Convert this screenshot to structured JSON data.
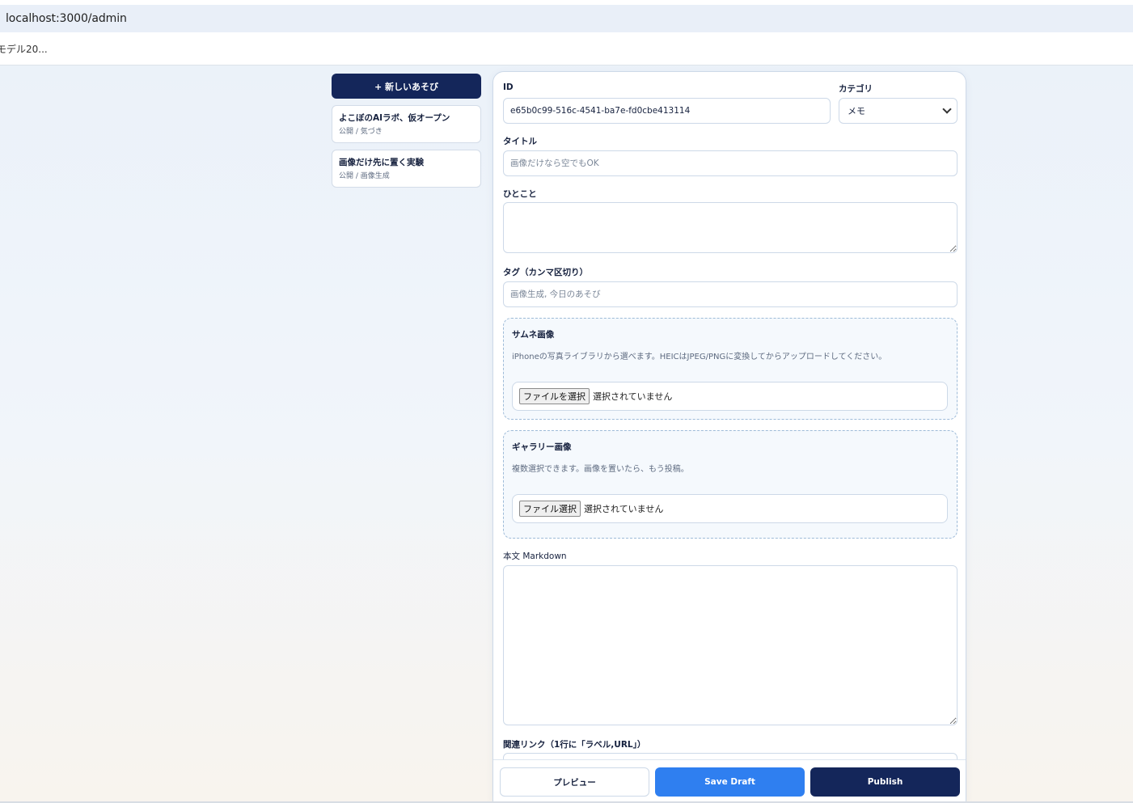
{
  "browser": {
    "url": "localhost:3000/admin",
    "bookmark": "モデル20..."
  },
  "sidebar": {
    "new_button": "+ 新しいあそび",
    "posts": [
      {
        "title": "よこぼのAIラボ、仮オープン",
        "meta": "公開 / 気づき"
      },
      {
        "title": "画像だけ先に置く実験",
        "meta": "公開 / 画像生成"
      }
    ]
  },
  "editor": {
    "id_label": "ID",
    "id_value": "e65b0c99-516c-4541-ba7e-fd0cbe413114",
    "category_label": "カテゴリ",
    "category_value": "メモ",
    "title_label": "タイトル",
    "title_placeholder": "画像だけなら空でもOK",
    "comment_label": "ひとこと",
    "tags_label": "タグ（カンマ区切り）",
    "tags_placeholder": "画像生成, 今日のあそび",
    "thumbnail": {
      "heading": "サムネ画像",
      "description": "iPhoneの写真ライブラリから選べます。HEICはJPEG/PNGに変換してからアップロードしてください。",
      "button": "ファイルを選択",
      "status": "選択されていません"
    },
    "gallery": {
      "heading": "ギャラリー画像",
      "description": "複数選択できます。画像を置いたら、もう投稿。",
      "button": "ファイル選択",
      "status": "選択されていません"
    },
    "body_label": "本文 Markdown",
    "links_label": "関連リンク（1行に「ラベル,URL」）"
  },
  "actions": {
    "preview": "プレビュー",
    "save_draft": "Save Draft",
    "publish": "Publish"
  },
  "colors": {
    "navy": "#14265a",
    "blue": "#2f7ff0",
    "border": "#cdd9e8"
  }
}
